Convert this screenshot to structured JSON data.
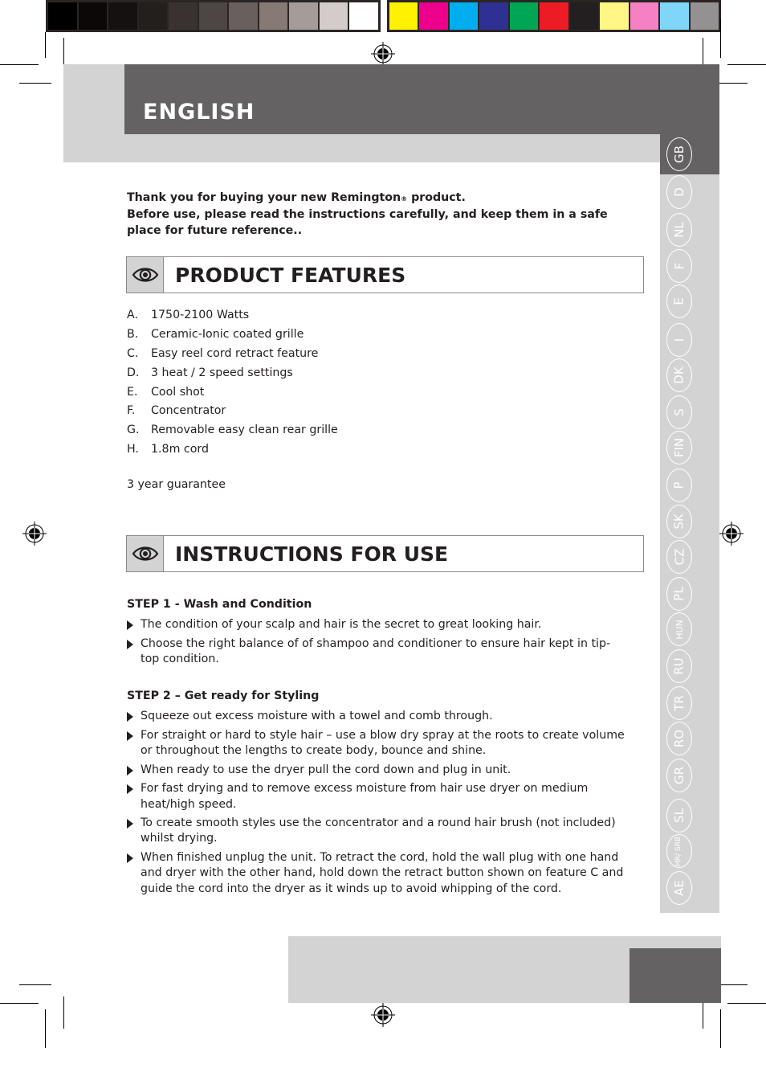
{
  "color_bar": {
    "left_swatches": [
      "#000000",
      "#0b0807",
      "#141110",
      "#231f1c",
      "#3a3230",
      "#4e4644",
      "#695f5c",
      "#877a75",
      "#a59b98",
      "#d4cbcb",
      "#ffffff"
    ],
    "right_swatches": [
      "#fff100",
      "#ec008c",
      "#00aeef",
      "#2e3192",
      "#00a651",
      "#ed1c24",
      "#231f20",
      "#fff684",
      "#f580c2",
      "#7fd6f7",
      "#939191"
    ]
  },
  "header": {
    "title": "ENGLISH"
  },
  "languages": [
    {
      "code": "GB",
      "active": true
    },
    {
      "code": "D"
    },
    {
      "code": "NL"
    },
    {
      "code": "F"
    },
    {
      "code": "E"
    },
    {
      "code": "I"
    },
    {
      "code": "DK"
    },
    {
      "code": "S"
    },
    {
      "code": "FIN"
    },
    {
      "code": "P"
    },
    {
      "code": "SK"
    },
    {
      "code": "CZ"
    },
    {
      "code": "PL"
    },
    {
      "code": "HUN"
    },
    {
      "code": "RU"
    },
    {
      "code": "TR"
    },
    {
      "code": "RO"
    },
    {
      "code": "GR"
    },
    {
      "code": "SL"
    },
    {
      "code": "HR/ SRB"
    },
    {
      "code": "AE"
    }
  ],
  "intro": {
    "line1_before": "Thank you for buying your new Remington",
    "registered_mark": "®",
    "line1_after": " product.",
    "line2": "Before use, please read the instructions carefully, and keep them in a safe place for future reference.."
  },
  "product_features": {
    "icon": "eye-icon",
    "title": "PRODUCT FEATURES",
    "items": [
      {
        "key": "A.",
        "text": "1750-2100 Watts"
      },
      {
        "key": "B.",
        "text": "Ceramic-Ionic coated grille"
      },
      {
        "key": "C.",
        "text": "Easy reel cord retract feature"
      },
      {
        "key": "D.",
        "text": "3 heat / 2 speed settings"
      },
      {
        "key": "E.",
        "text": "Cool shot"
      },
      {
        "key": "F.",
        "text": "Concentrator"
      },
      {
        "key": "G.",
        "text": "Removable easy clean rear grille"
      },
      {
        "key": "H.",
        "text": "1.8m cord"
      }
    ],
    "guarantee": "3 year guarantee"
  },
  "instructions": {
    "icon": "eye-icon",
    "title": "INSTRUCTIONS FOR USE",
    "steps": [
      {
        "title": "STEP 1 - Wash and Condition",
        "bullets": [
          "The condition of your scalp and hair is the secret to great looking hair.",
          "Choose the right balance of of shampoo and conditioner to ensure hair kept in tip-top condition."
        ]
      },
      {
        "title": "STEP 2 – Get ready for Styling",
        "bullets": [
          "Squeeze out excess moisture with a towel and comb through.",
          "For straight or hard to style hair – use a blow dry spray at the roots to create volume or throughout the lengths to create body, bounce and shine.",
          "When ready to use the dryer pull the cord down and plug in unit.",
          "For fast drying and to remove excess moisture from hair use dryer on medium heat/high speed.",
          "To create smooth styles use the concentrator and a round hair brush (not included) whilst drying.",
          "When finished unplug the unit. To retract the cord, hold the wall plug with one hand and dryer with the other hand, hold down the retract button shown on feature C and guide the cord into the dryer as it winds up to avoid whipping of the cord."
        ]
      }
    ]
  }
}
